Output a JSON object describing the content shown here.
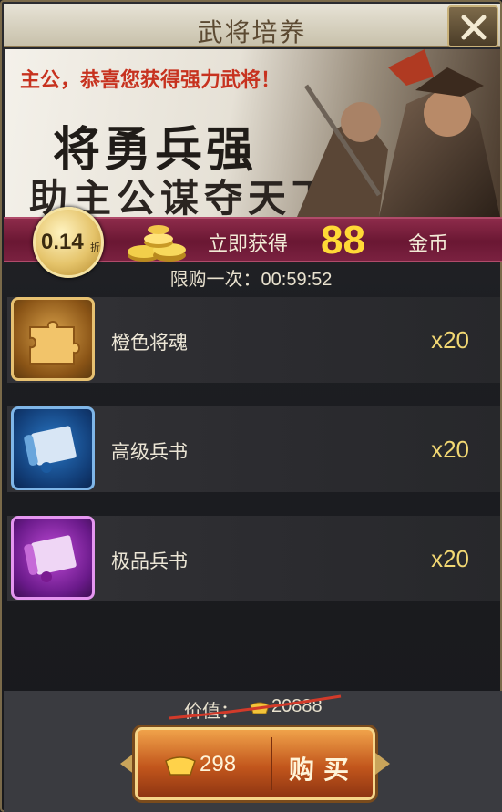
{
  "header": {
    "title": "武将培养"
  },
  "banner": {
    "slogan": "主公，恭喜您获得强力武将！",
    "headline1": "将勇兵强",
    "headline2": "助主公谋夺天下"
  },
  "offer": {
    "discount": "0.14",
    "discount_unit": "折",
    "instant_label": "立即获得",
    "gold_amount": "88",
    "gold_unit": "金币",
    "limit_text": "限购一次：00:59:52"
  },
  "items": [
    {
      "name": "橙色将魂",
      "qty": "x20",
      "icon": "orange-puzzle-icon"
    },
    {
      "name": "高级兵书",
      "qty": "x20",
      "icon": "blue-scroll-icon"
    },
    {
      "name": "极品兵书",
      "qty": "x20",
      "icon": "purple-scroll-icon"
    }
  ],
  "footer": {
    "value_label": "价值：",
    "value_amount": "20888",
    "buy_price": "298",
    "buy_label": "购买"
  },
  "colors": {
    "strip": "#6a1733",
    "gold": "#ffd936",
    "qty": "#f2d873",
    "button": "#c2561c"
  }
}
